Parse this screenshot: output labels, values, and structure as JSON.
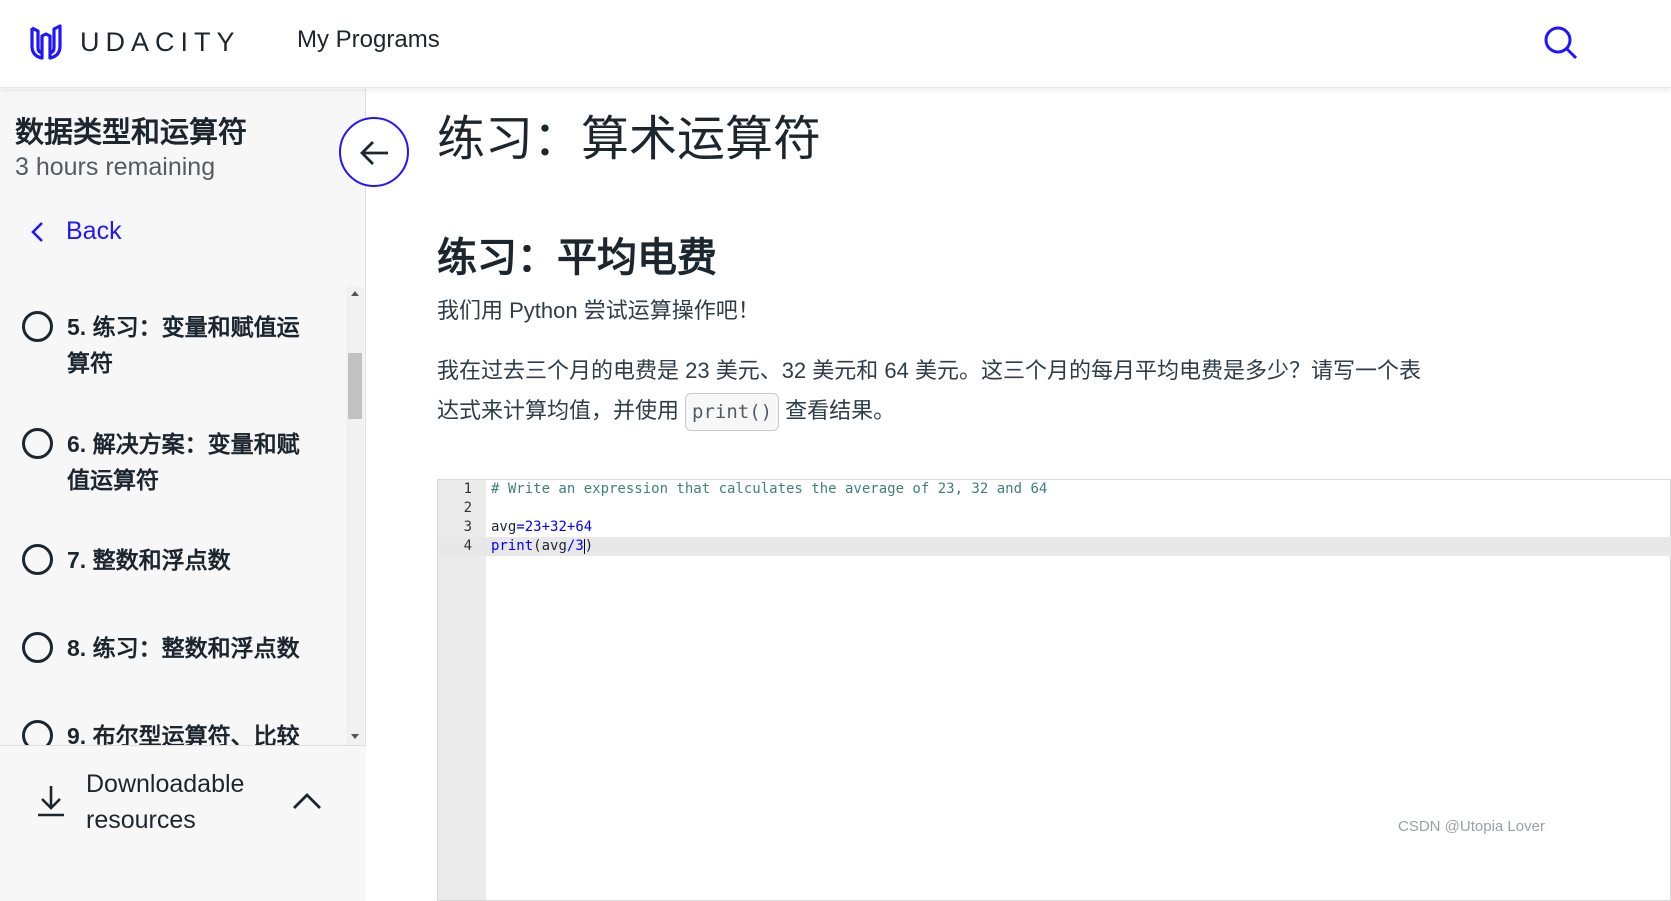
{
  "header": {
    "logo_text": "UDACITY",
    "nav_programs": "My Programs",
    "brand_color": "#2015ff"
  },
  "sidebar": {
    "course_title": "数据类型和运算符",
    "time_remaining": "3 hours remaining",
    "back_label": "Back",
    "lessons": [
      {
        "label": "5. 练习：变量和赋值运算符",
        "status": "incomplete"
      },
      {
        "label": "6. 解决方案：变量和赋值运算符",
        "status": "incomplete"
      },
      {
        "label": "7. 整数和浮点数",
        "status": "incomplete"
      },
      {
        "label": "8. 练习：整数和浮点数",
        "status": "incomplete"
      },
      {
        "label": "9. 布尔型运算符、比较",
        "status": "incomplete"
      }
    ],
    "resources_label": "Downloadable resources"
  },
  "main": {
    "page_title": "练习：算术运算符",
    "section_title": "练习：平均电费",
    "para1": "我们用 Python 尝试运算操作吧！",
    "para2_before": "我在过去三个月的电费是 23 美元、32 美元和 64 美元。这三个月的每月平均电费是多少？请写一个表达式来计算均值，并使用",
    "para2_code": "print()",
    "para2_after": "查看结果。"
  },
  "editor": {
    "lines": [
      {
        "num": "1",
        "text": "# Write an expression that calculates the average of 23, 32 and 64"
      },
      {
        "num": "2",
        "text": ""
      },
      {
        "num": "3",
        "text": "avg=23+32+64"
      },
      {
        "num": "4",
        "text": "print(avg/3)"
      }
    ],
    "active_line": 4
  },
  "watermark": "CSDN @Utopia Lover"
}
